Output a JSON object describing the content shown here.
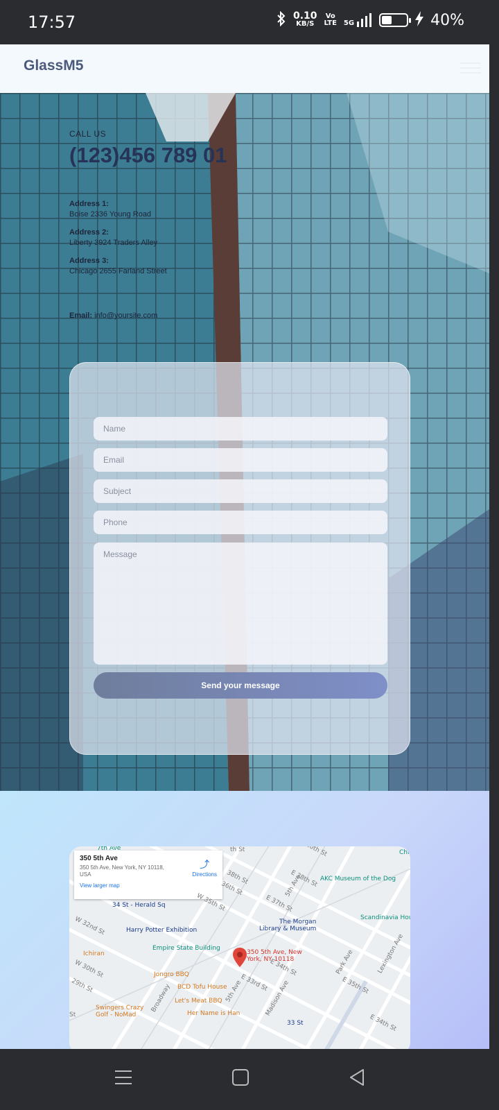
{
  "status_bar": {
    "time": "17:57",
    "net_speed": "0.10",
    "net_unit": "KB/S",
    "volte_top": "Vo",
    "volte_bottom": "LTE",
    "signal": "5G",
    "battery_percent": "40%",
    "battery_level": 0.4
  },
  "site": {
    "logo": "GlassM5"
  },
  "contact": {
    "call_label": "CALL US",
    "phone": "(123)456 789 01",
    "addresses": [
      {
        "title": "Address 1:",
        "line": "Boise 2336 Young Road"
      },
      {
        "title": "Address 2:",
        "line": "Liberty 3924 Traders Alley"
      },
      {
        "title": "Address 3:",
        "line": "Chicago 2655 Farland Street"
      }
    ],
    "email_label": "Email:",
    "email_value": "info@yoursite.com"
  },
  "form": {
    "name_placeholder": "Name",
    "email_placeholder": "Email",
    "subject_placeholder": "Subject",
    "phone_placeholder": "Phone",
    "message_placeholder": "Message",
    "submit_label": "Send your message"
  },
  "map": {
    "place_title": "350 5th Ave",
    "place_address": "350 5th Ave, New York, NY 10118, USA",
    "view_larger": "View larger map",
    "directions": "Directions",
    "pin_label_1": "350 5th Ave, New",
    "pin_label_2": "York, NY 10118",
    "labels": {
      "ave7": "7th Ave",
      "herald": "34 St - Herald Sq",
      "akc": "AKC Museum of the Dog",
      "scandinavia": "Scandinavia Hou",
      "morgan1": "The Morgan",
      "morgan2": "Library & Museum",
      "potter": "Harry Potter Exhibition",
      "esb": "Empire State Building",
      "ichiran": "Ichiran",
      "jongro": "Jongro BBQ",
      "bcd": "BCD Tofu House",
      "letsmeat": "Let's Meat BBQ",
      "swingers1": "Swingers Crazy",
      "swingers2": "Golf - NoMad",
      "hername": "Her Name is Han",
      "st33": "33 St",
      "w32": "W 32nd St",
      "w30": "W 30th St",
      "w29": "29th St",
      "w35": "W 35th St",
      "st36": "36th St",
      "e38": "E 38th St",
      "e37": "E 37th St",
      "e34": "E 34th St",
      "e33": "E 33rd St",
      "e35": "E 35th St",
      "e34b": "E 34th St",
      "st40": "40th St",
      "ave5": "5th Ave",
      "ave5b": "5th Ave",
      "madison": "Madison Ave",
      "park": "Park Ave",
      "lexington": "Lexington Ave",
      "broadway": "Broadway",
      "st38": "38th St",
      "chi": "Chi",
      "stp": "St",
      "sth": "th St",
      "ave6": "6th St"
    }
  }
}
